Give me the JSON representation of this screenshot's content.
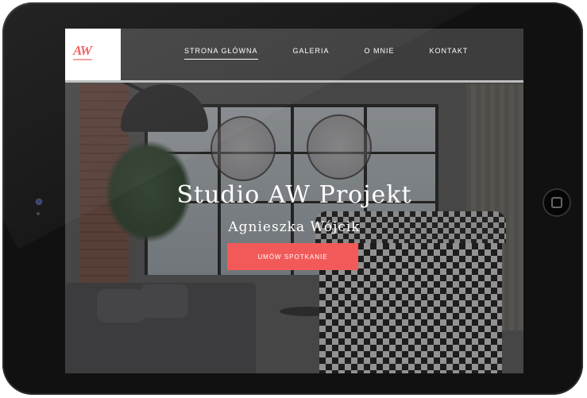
{
  "colors": {
    "accent": "#f25a5a",
    "header_bg": "#3d3d3d",
    "bezel": "#111111"
  },
  "site": {
    "logo_text": "AW",
    "nav": [
      {
        "label": "STRONA GŁÓWNA",
        "active": true
      },
      {
        "label": "GALERIA",
        "active": false
      },
      {
        "label": "O MNIE",
        "active": false
      },
      {
        "label": "KONTAKT",
        "active": false
      }
    ]
  },
  "hero": {
    "title": "Studio AW Projekt",
    "subtitle": "Agnieszka Wójcik",
    "cta_label": "UMÓW SPOTKANIE"
  },
  "device": {
    "home_button_icon": "home-button-icon",
    "camera_icon": "front-camera-icon"
  }
}
